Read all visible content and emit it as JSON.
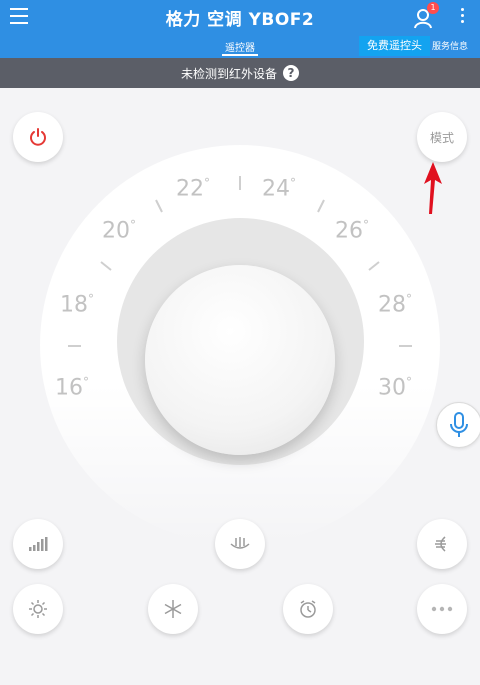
{
  "header": {
    "title": "格力 空调 YBOF2",
    "badge_count": "1",
    "tab_remote": "遥控器",
    "free_button": "免费遥控头",
    "tab_service": "服务信息"
  },
  "notice": {
    "text": "未检测到红外设备",
    "help": "?"
  },
  "controls": {
    "mode_label": "模式"
  },
  "dial": {
    "labels": [
      {
        "value": "16",
        "unit": "°"
      },
      {
        "value": "18",
        "unit": "°"
      },
      {
        "value": "20",
        "unit": "°"
      },
      {
        "value": "22",
        "unit": "°"
      },
      {
        "value": "24",
        "unit": "°"
      },
      {
        "value": "26",
        "unit": "°"
      },
      {
        "value": "28",
        "unit": "°"
      },
      {
        "value": "30",
        "unit": "°"
      }
    ]
  },
  "colors": {
    "header_bg": "#2f8fe3",
    "power_icon": "#e53935",
    "arrow": "#e0101f",
    "mic_icon": "#2f8fe3"
  }
}
